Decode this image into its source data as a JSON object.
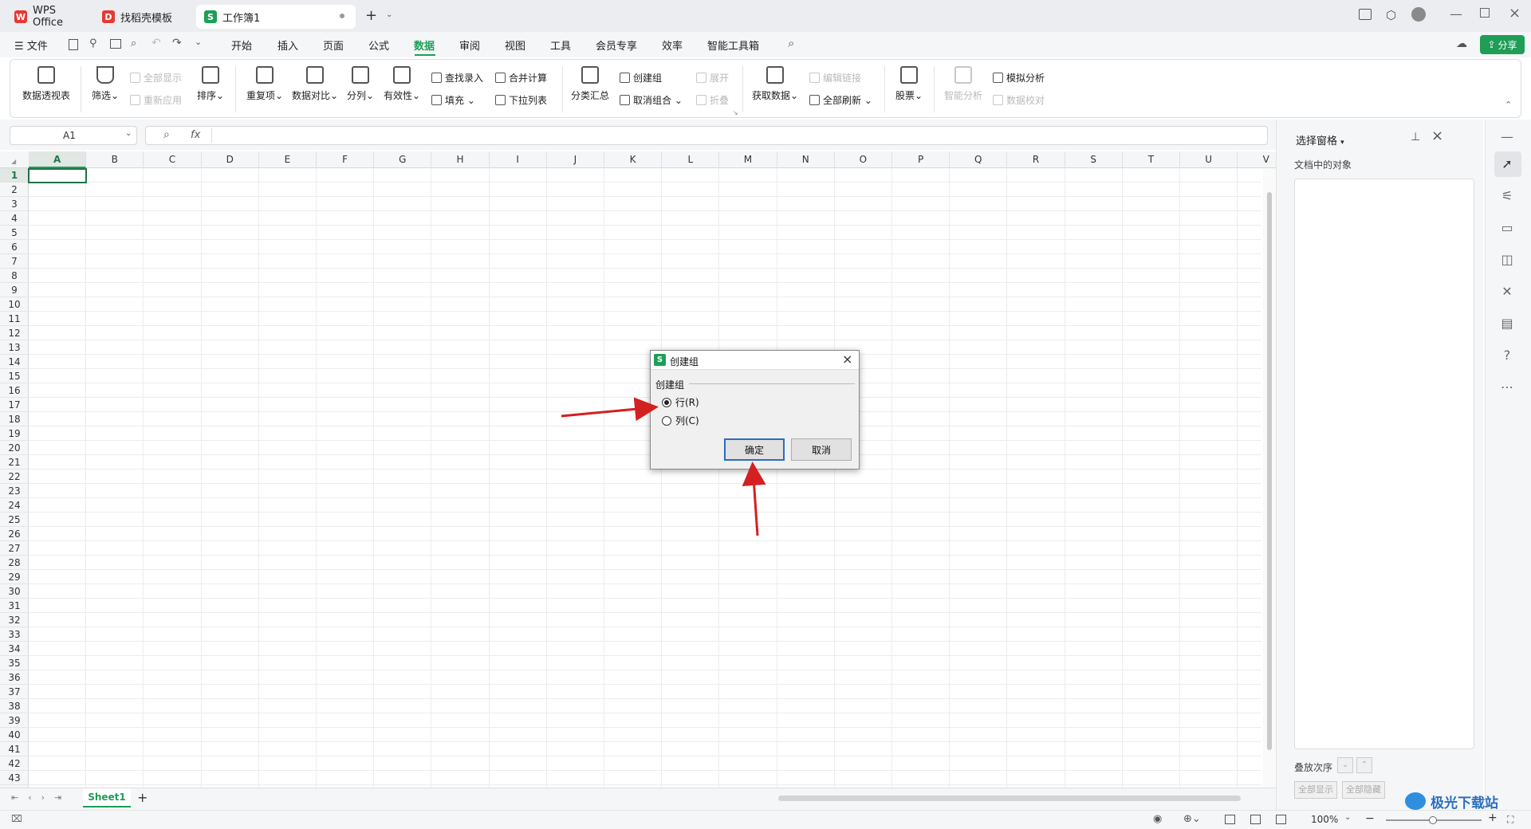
{
  "tabs": [
    {
      "label": "WPS Office",
      "icon": "wps-logo-icon",
      "color": "#e53935"
    },
    {
      "label": "找稻壳模板",
      "icon": "docer-logo-icon",
      "color": "#e53935"
    },
    {
      "label": "工作簿1",
      "icon": "spreadsheet-s-icon",
      "color": "#1e9e57"
    }
  ],
  "menu": {
    "file_label": "文件",
    "items": [
      "开始",
      "插入",
      "页面",
      "公式",
      "数据",
      "审阅",
      "视图",
      "工具",
      "会员专享",
      "效率",
      "智能工具箱"
    ],
    "active": "数据",
    "share_label": "分享"
  },
  "ribbon": {
    "pivot": "数据透视表",
    "filter": "筛选",
    "show_all": "全部显示",
    "reapply": "重新应用",
    "sort": "排序",
    "duplicates": "重复项",
    "compare": "数据对比",
    "split": "分列",
    "validity": "有效性",
    "lookup_entry": "查找录入",
    "fill": "填充",
    "consolidate": "合并计算",
    "dropdown_list": "下拉列表",
    "subtotal": "分类汇总",
    "create_group": "创建组",
    "ungroup": "取消组合",
    "expand": "展开",
    "collapse": "折叠",
    "get_data": "获取数据",
    "edit_links": "编辑链接",
    "refresh_all": "全部刷新",
    "stock": "股票",
    "smart_analysis": "智能分析",
    "what_if": "模拟分析",
    "data_check": "数据校对"
  },
  "formula_bar": {
    "cell_ref": "A1",
    "fx": "fx",
    "value": ""
  },
  "grid": {
    "columns": [
      "A",
      "B",
      "C",
      "D",
      "E",
      "F",
      "G",
      "H",
      "I",
      "J",
      "K",
      "L",
      "M",
      "N",
      "O",
      "P",
      "Q",
      "R",
      "S",
      "T",
      "U",
      "V"
    ],
    "rows": [
      "1",
      "2",
      "3",
      "4",
      "5",
      "6",
      "7",
      "8",
      "9",
      "10",
      "11",
      "12",
      "13",
      "14",
      "15",
      "16",
      "17",
      "18",
      "19",
      "20",
      "21",
      "22",
      "23",
      "24",
      "25",
      "26",
      "27",
      "28",
      "29",
      "30",
      "31",
      "32",
      "33",
      "34",
      "35",
      "36",
      "37",
      "38",
      "39",
      "40",
      "41",
      "42",
      "43"
    ],
    "selected_cell": "A1"
  },
  "sheet_tab": "Sheet1",
  "status": {
    "zoom": "100%"
  },
  "selection_pane": {
    "title": "选择窗格",
    "objects_label": "文档中的对象",
    "order_label": "叠放次序",
    "show_all": "全部显示",
    "hide_all": "全部隐藏"
  },
  "dialog": {
    "title": "创建组",
    "group_label": "创建组",
    "options": [
      "行(R)",
      "列(C)"
    ],
    "selected": "行(R)",
    "ok_label": "确定",
    "cancel_label": "取消"
  },
  "watermark": "极光下载站",
  "annotation_color": "#d32020"
}
